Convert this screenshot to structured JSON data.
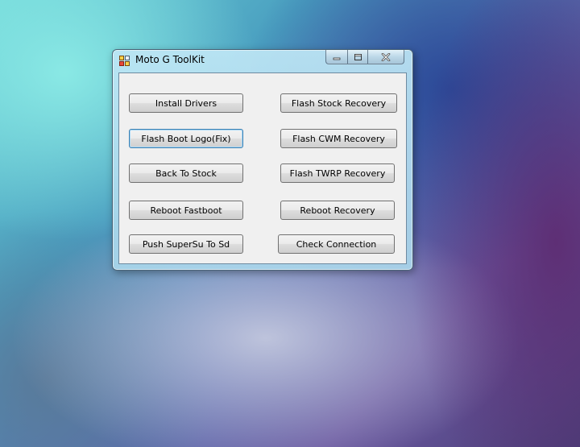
{
  "window": {
    "title": "Moto G ToolKit"
  },
  "icons": {
    "app": "app-icon",
    "minimize": "minimize-icon",
    "maximize": "maximize-icon",
    "close": "close-icon"
  },
  "buttons": {
    "install_drivers": "Install Drivers",
    "flash_stock_recovery": "Flash Stock Recovery",
    "flash_boot_logo": "Flash Boot Logo(Fix)",
    "flash_cwm_recovery": "Flash CWM Recovery",
    "back_to_stock": "Back To Stock",
    "flash_twrp_recovery": "Flash TWRP Recovery",
    "reboot_fastboot": "Reboot Fastboot",
    "reboot_recovery": "Reboot Recovery",
    "push_supersu": "Push SuperSu To Sd",
    "check_connection": "Check Connection"
  },
  "colors": {
    "focus_border": "#3c7fb1",
    "client_bg": "#f0f0f0"
  }
}
